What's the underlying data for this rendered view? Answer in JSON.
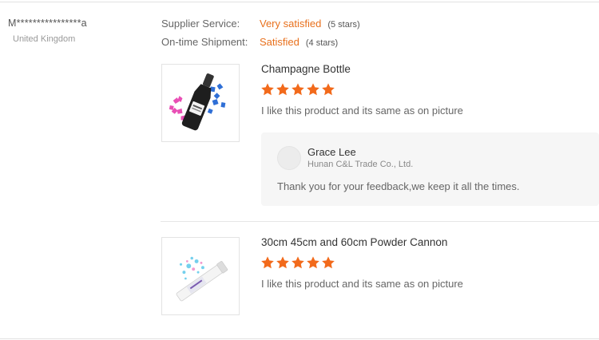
{
  "buyer": {
    "name": "M****************a",
    "country": "United Kingdom"
  },
  "ratings": [
    {
      "label": "Supplier Service:",
      "value": "Very satisfied",
      "stars_text": "(5 stars)"
    },
    {
      "label": "On-time Shipment:",
      "value": "Satisfied",
      "stars_text": "(4 stars)"
    }
  ],
  "reviews": [
    {
      "product_title": "Champagne Bottle",
      "star_rating": 5,
      "text": "I like this product and its same as on picture",
      "image_icon": "champagne-bottle-image"
    },
    {
      "product_title": "30cm 45cm and 60cm Powder Cannon",
      "star_rating": 5,
      "text": "I like this product and its same as on picture",
      "image_icon": "powder-cannon-image"
    }
  ],
  "reply": {
    "name": "Grace Lee",
    "company": "Hunan C&L Trade Co., Ltd.",
    "text": "Thank you for your feedback,we keep it all the times."
  },
  "colors": {
    "accent": "#e8701c",
    "star": "#f26a1b",
    "reply_bg": "#f6f6f6"
  }
}
